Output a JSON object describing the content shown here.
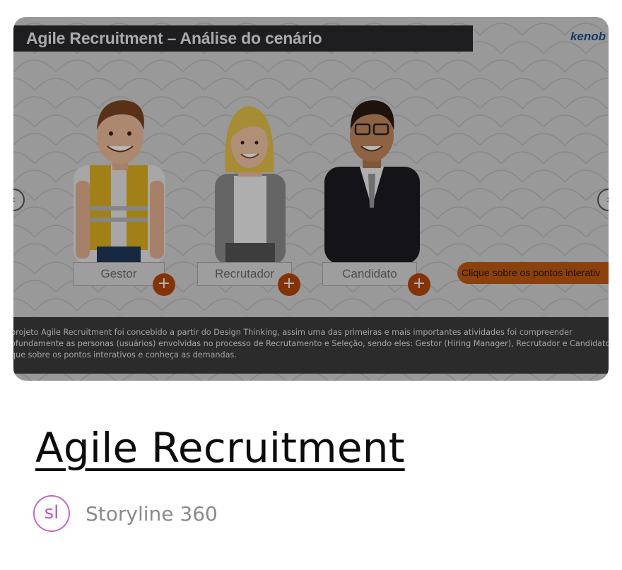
{
  "slide": {
    "title": "Agile Recruitment – Análise do cenário",
    "brand": "kenob",
    "personas": [
      {
        "label": "Gestor"
      },
      {
        "label": "Recrutador"
      },
      {
        "label": "Candidato"
      }
    ],
    "plus_symbol": "+",
    "cta": "Clique sobre os pontos interativ",
    "description_lines": [
      "projeto Agile Recruitment foi concebido a partir do Design Thinking, assim uma das primeiras e mais importantes atividades foi compreender",
      "ofundamente as personas (usuários) envolvidas no processo de Recrutamento e Seleção, sendo eles: Gestor (Hiring Manager), Recrutador e Candidato",
      "que sobre os pontos interativos e conheça as demandas."
    ],
    "prev_arrow": "‹",
    "next_arrow": "›"
  },
  "card": {
    "title": "Agile Recruitment",
    "tool_badge": "sl",
    "tool_name": "Storyline 360"
  },
  "colors": {
    "accent_orange": "#b8470b",
    "badge_purple": "#c766c2"
  }
}
